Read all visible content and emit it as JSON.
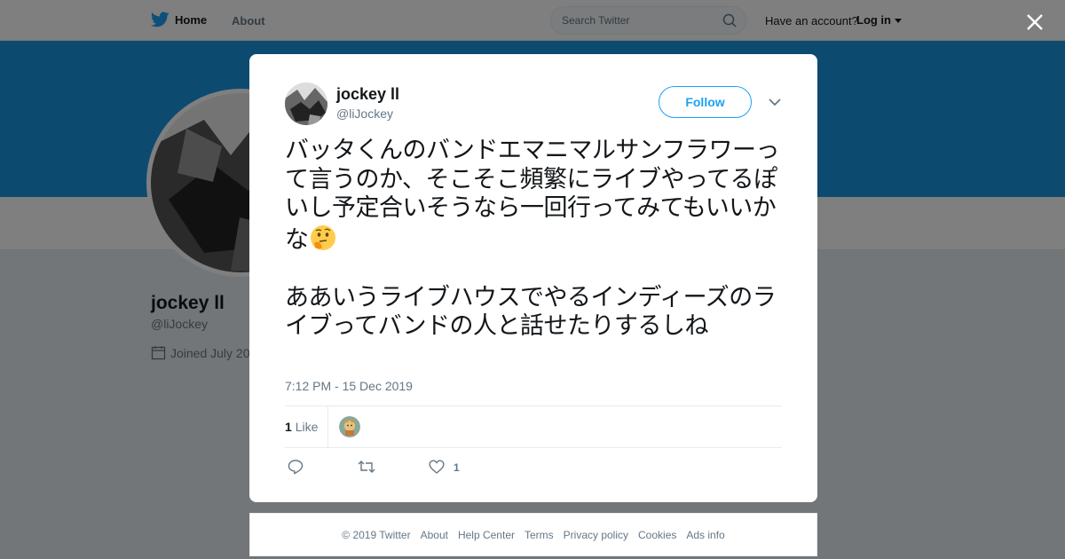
{
  "topbar": {
    "home_label": "Home",
    "about_label": "About",
    "search_placeholder": "Search Twitter",
    "account_prompt": "Have an account?",
    "login_label": "Log in"
  },
  "profile": {
    "name": "jockey ll",
    "handle": "@liJockey",
    "joined": "Joined July 20"
  },
  "tweet": {
    "author_name": "jockey ll",
    "author_handle": "@liJockey",
    "follow_label": "Follow",
    "text_part1": "バッタくんのバンドエマニマルサンフラワーって言うのか、そこそこ頻繁にライブやってるぽいし予定合いそうなら一回行ってみてもいいかな",
    "text_part2": "\n\nああいうライブハウスでやるインディーズのライブってバンドの人と話せたりするしね",
    "timestamp": "7:12 PM - 15 Dec 2019",
    "like_count": "1",
    "like_label": "Like",
    "action_like_count": "1"
  },
  "footer": {
    "copyright": "© 2019 Twitter",
    "links": [
      "About",
      "Help Center",
      "Terms",
      "Privacy policy",
      "Cookies",
      "Ads info"
    ]
  },
  "icons": {
    "brand": "twitter-bird-icon",
    "search": "search-icon",
    "close": "close-icon",
    "calendar": "calendar-icon",
    "chevron": "chevron-down-icon",
    "reply": "reply-icon",
    "retweet": "retweet-icon",
    "like": "heart-icon",
    "emoji": "thinking-face-emoji"
  },
  "colors": {
    "brand_blue": "#1da1f2",
    "banner": "#1b95e0",
    "muted_text": "#657786",
    "overlay": "rgba(0,0,0,0.5)"
  }
}
